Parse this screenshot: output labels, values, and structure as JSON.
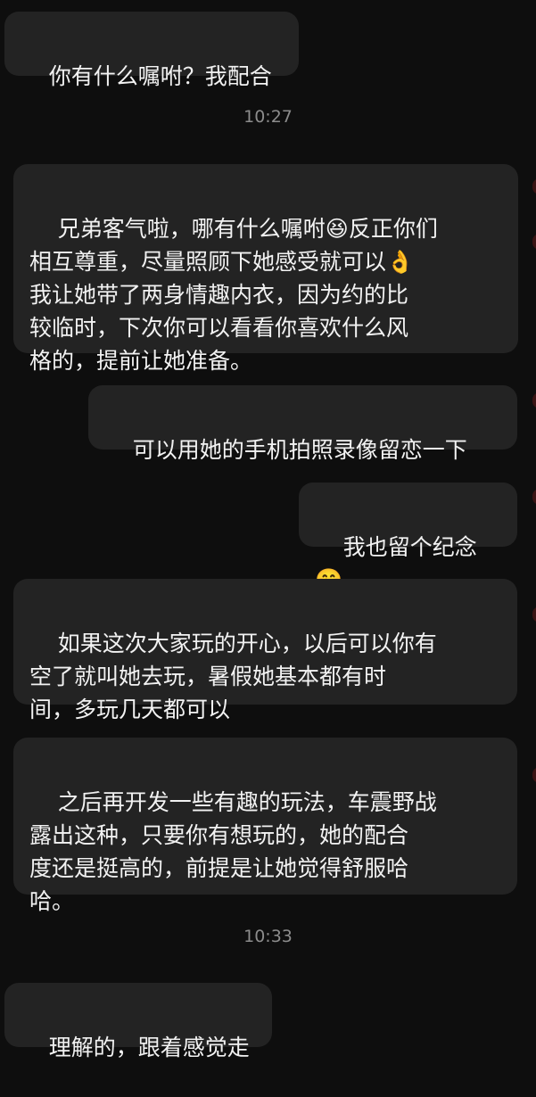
{
  "messages": [
    {
      "side": "left",
      "text": "你有什么嘱咐？我配合"
    },
    {
      "side": "left",
      "text": "兄弟客气啦，哪有什么嘱咐😆反正你们\n相互尊重，尽量照顾下她感受就可以👌\n我让她带了两身情趣内衣，因为约的比\n较临时，下次你可以看看你喜欢什么风\n格的，提前让她准备。"
    },
    {
      "side": "right",
      "text": "可以用她的手机拍照录像留恋一下"
    },
    {
      "side": "right",
      "text": "我也留个纪念🤭"
    },
    {
      "side": "left",
      "text": "如果这次大家玩的开心，以后可以你有\n空了就叫她去玩，暑假她基本都有时\n间，多玩几天都可以"
    },
    {
      "side": "left",
      "text": "之后再开发一些有趣的玩法，车震野战\n露出这种，只要你有想玩的，她的配合\n度还是挺高的，前提是让她觉得舒服哈\n哈。"
    },
    {
      "side": "left",
      "text": "理解的，跟着感觉走"
    }
  ],
  "timestamps": [
    "10:27",
    "10:33"
  ],
  "colors": {
    "background": "#0e0e0e",
    "bubble": "#232323",
    "text": "#f2f2f2",
    "timestamp": "#8c8c8c"
  }
}
